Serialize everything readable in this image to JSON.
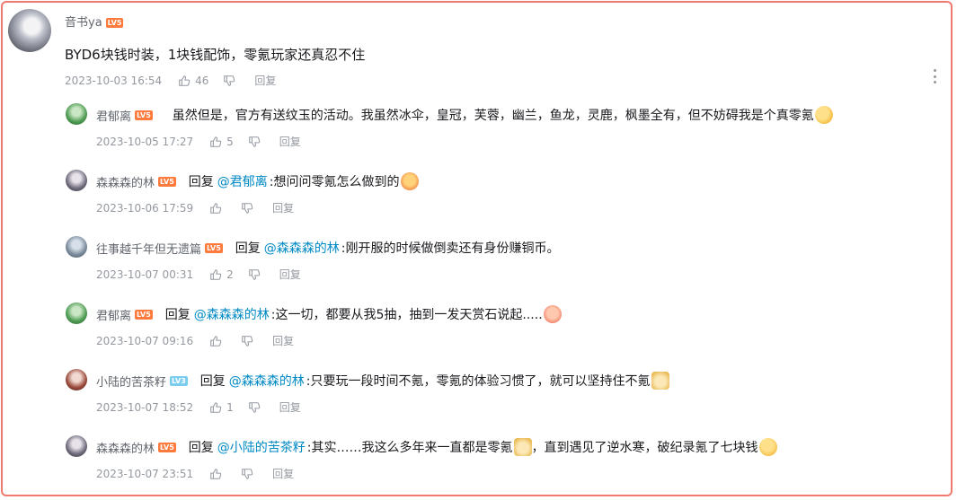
{
  "root": {
    "username": "音书ya",
    "level": "LV5",
    "text": "BYD6块钱时装，1块钱配饰，零氪玩家还真忍不住",
    "time": "2023-10-03 16:54",
    "likes": "46",
    "reply_label": "回复"
  },
  "replies": [
    {
      "user": "君郁离",
      "level": "LV5",
      "reply_word": "",
      "mention": "",
      "text": "虽然但是，官方有送纹玉的活动。我虽然冰伞，皇冠，芙蓉，幽兰，鱼龙，灵鹿，枫墨全有，但不妨碍我是个真零氪",
      "emote": "dizzy-emote",
      "time": "2023-10-05 17:27",
      "likes": "5",
      "reply_label": "回复"
    },
    {
      "user": "森森森的林",
      "level": "LV5",
      "reply_word": "回复",
      "mention": "@君郁离",
      "text": ":想问问零氪怎么做到的",
      "emote": "crying-emote",
      "time": "2023-10-06 17:59",
      "likes": "",
      "reply_label": "回复"
    },
    {
      "user": "往事越千年但无遗篇",
      "level": "LV5",
      "reply_word": "回复",
      "mention": "@森森森的林",
      "text": ":刚开服的时候做倒卖还有身份赚铜币。",
      "emote": "",
      "time": "2023-10-07 00:31",
      "likes": "2",
      "reply_label": "回复"
    },
    {
      "user": "君郁离",
      "level": "LV5",
      "reply_word": "回复",
      "mention": "@森森森的林",
      "text": ":这一切，都要从我5抽，抽到一发天赏石说起.....",
      "emote": "shy-emote",
      "time": "2023-10-07 09:16",
      "likes": "",
      "reply_label": "回复"
    },
    {
      "user": "小陆的苦茶籽",
      "level": "LV3",
      "reply_word": "回复",
      "mention": "@森森森的林",
      "text": ":只要玩一段时间不氪，零氪的体验习惯了，就可以坚持住不氪",
      "emote": "doge-emote",
      "time": "2023-10-07 18:52",
      "likes": "1",
      "reply_label": "回复"
    },
    {
      "user": "森森森的林",
      "level": "LV5",
      "reply_word": "回复",
      "mention": "@小陆的苦茶籽",
      "text": ":其实……我这么多年来一直都是零氪",
      "text2": "，直到遇见了逆水寒，破纪录氪了七块钱",
      "emote": "doge-emote",
      "emote2": "sob-emote",
      "time": "2023-10-07 23:51",
      "likes": "",
      "reply_label": "回复"
    }
  ],
  "colors": {
    "accent": "#008ac5",
    "level": "#ff7a3d",
    "border": "#f07a70"
  }
}
